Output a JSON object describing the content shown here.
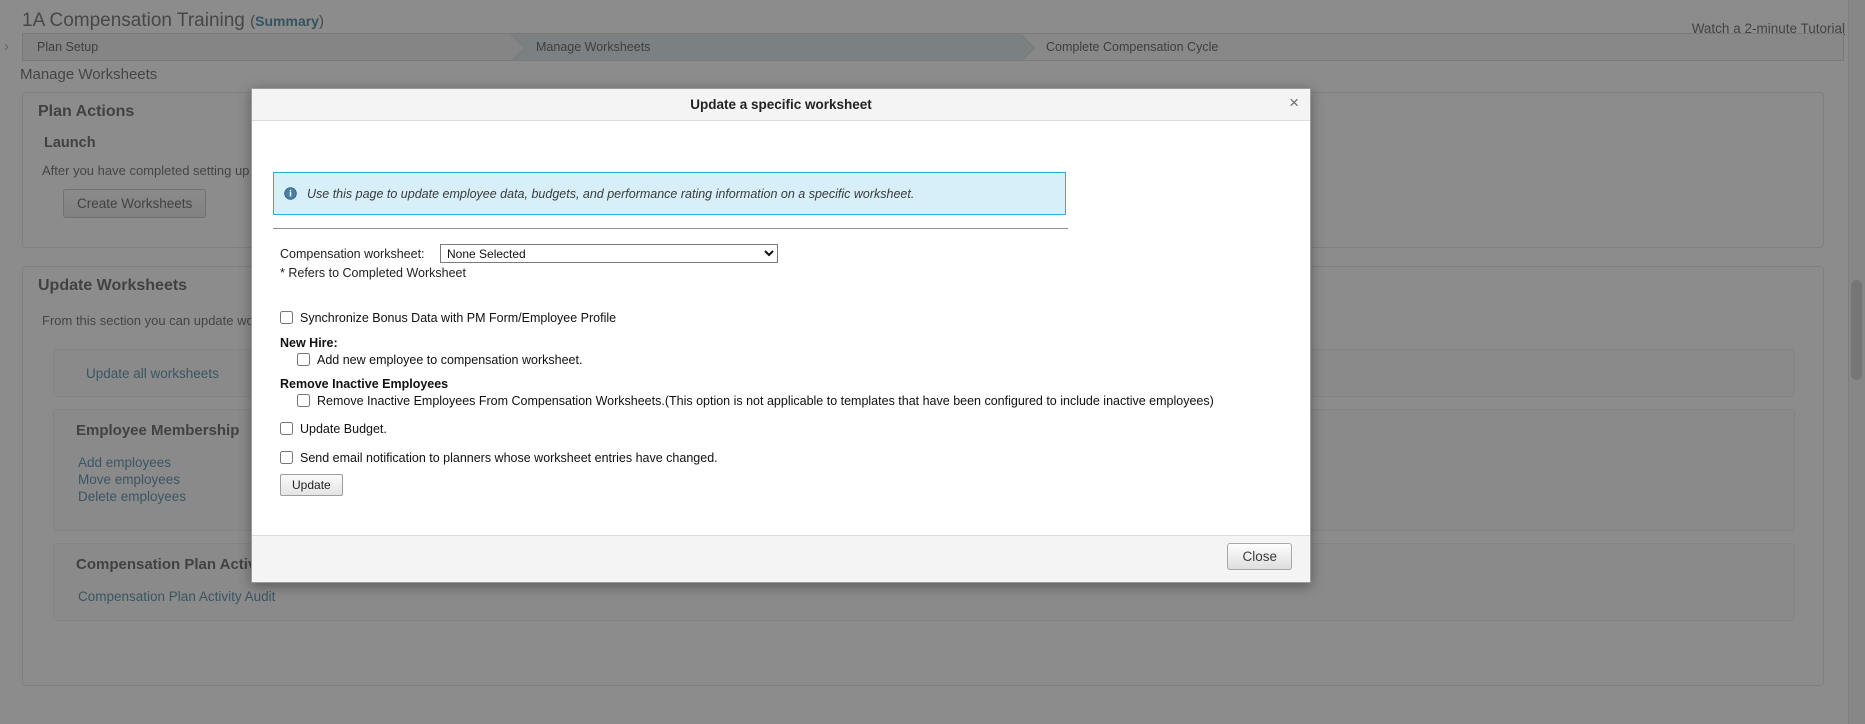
{
  "page": {
    "title_main": "1A Compensation Training",
    "paren_open": "(",
    "summary_link": "Summary",
    "paren_close": ")",
    "tutorial_link": "Watch a 2-minute Tutorial",
    "subtitle": "Manage Worksheets"
  },
  "wizard": {
    "steps": [
      {
        "label": "Plan Setup",
        "state": "complete"
      },
      {
        "label": "Manage Worksheets",
        "state": "active"
      },
      {
        "label": "Complete Compensation Cycle",
        "state": "upcoming"
      }
    ]
  },
  "plan_actions": {
    "title": "Plan Actions",
    "subtitle": "Launch",
    "description": "After you have completed setting up your pl",
    "create_button": "Create Worksheets"
  },
  "update_worksheets": {
    "title": "Update Worksheets",
    "description": "From this section you can update worksheet",
    "update_all_link": "Update all worksheets",
    "membership": {
      "title": "Employee Membership",
      "links": [
        "Add employees",
        "Move employees",
        "Delete employees"
      ]
    },
    "audit": {
      "title": "Compensation Plan Activity Audit",
      "link": "Compensation Plan Activity Audit"
    }
  },
  "modal": {
    "title": "Update a specific worksheet",
    "close_x": "×",
    "info_banner": "Use this page to update employee data, budgets, and performance rating information on a specific worksheet.",
    "info_icon": "info-circle-icon",
    "worksheet_label": "Compensation worksheet:",
    "worksheet_selected": "None Selected",
    "worksheet_options": [
      "None Selected"
    ],
    "footnote": "* Refers to Completed Worksheet",
    "checkboxes": [
      {
        "id": "sync",
        "label": "Synchronize Bonus Data with PM Form/Employee Profile",
        "checked": false
      },
      {
        "id": "new_hire",
        "label": "Add new employee to compensation worksheet.",
        "checked": false
      },
      {
        "id": "remove_inactive",
        "label": "Remove Inactive Employees From Compensation Worksheets.(This option is not applicable to templates that have been configured to include inactive employees)",
        "checked": false
      },
      {
        "id": "budget",
        "label": "Update Budget.",
        "checked": false
      },
      {
        "id": "email",
        "label": "Send email notification to planners whose worksheet entries have changed.",
        "checked": false
      }
    ],
    "group_new_hire": "New Hire:",
    "group_remove_inactive": "Remove Inactive Employees",
    "update_button": "Update",
    "close_button": "Close"
  },
  "colors": {
    "link": "#2a6f94",
    "wizard_active": "#d3e1e4",
    "info_border": "#29b2d4",
    "info_bg": "#d7eff9",
    "overlay": "rgba(70,70,70,0.62)"
  }
}
